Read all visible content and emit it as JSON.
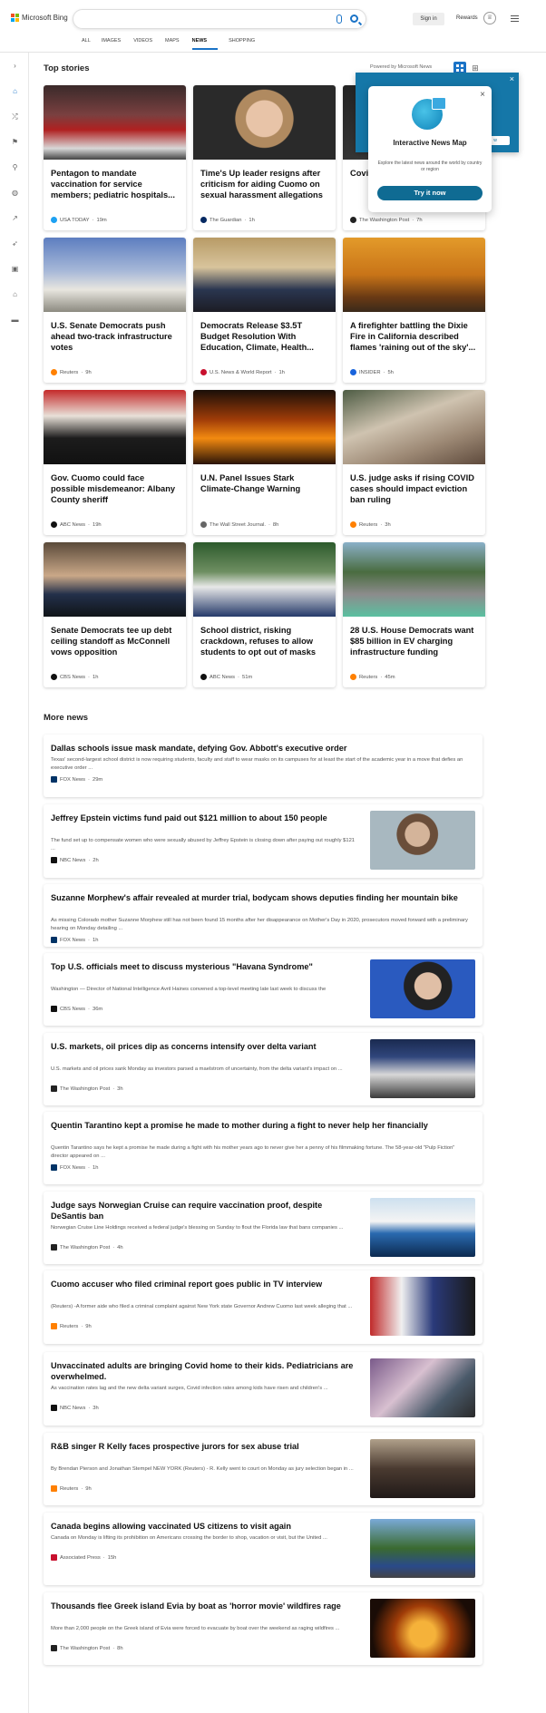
{
  "header": {
    "brand": "Microsoft Bing",
    "signin": "Sign in",
    "rewards": "Rewards",
    "scopes": [
      "ALL",
      "IMAGES",
      "VIDEOS",
      "MAPS",
      "NEWS",
      "SHOPPING"
    ],
    "active_scope": "NEWS"
  },
  "top_stories": {
    "title": "Top stories",
    "powered_by": "Powered by Microsoft News",
    "cards": [
      {
        "title": "Pentagon to mandate vaccination for service members; pediatric hospitals...",
        "source": "USA TODAY",
        "time": "19m",
        "color": "#1da1f2"
      },
      {
        "title": "Time's Up leader resigns after criticism for aiding Cuomo on sexual harassment allegations",
        "source": "The Guardian",
        "time": "1h",
        "color": "#052962"
      },
      {
        "title": "Covid... it's ta... kids",
        "source": "The Washington Post",
        "time": "7h",
        "color": "#222"
      },
      {
        "title": "U.S. Senate Democrats push ahead two-track infrastructure votes",
        "source": "Reuters",
        "time": "9h",
        "color": "#ff8000"
      },
      {
        "title": "Democrats Release $3.5T Budget Resolution With Education, Climate, Health...",
        "source": "U.S. News & World Report",
        "time": "1h",
        "color": "#c8102e"
      },
      {
        "title": "A firefighter battling the Dixie Fire in California described flames 'raining out of the sky'...",
        "source": "INSIDER",
        "time": "5h",
        "color": "#1863dc"
      },
      {
        "title": "Gov. Cuomo could face possible misdemeanor: Albany County sheriff",
        "source": "ABC News",
        "time": "19h",
        "color": "#111"
      },
      {
        "title": "U.N. Panel Issues Stark Climate-Change Warning",
        "source": "The Wall Street Journal.",
        "time": "8h",
        "color": "#666"
      },
      {
        "title": "U.S. judge asks if rising COVID cases should impact eviction ban ruling",
        "source": "Reuters",
        "time": "3h",
        "color": "#ff8000"
      },
      {
        "title": "Senate Democrats tee up debt ceiling standoff as McConnell vows opposition",
        "source": "CBS News",
        "time": "1h",
        "color": "#111"
      },
      {
        "title": "School district, risking crackdown, refuses to allow students to opt out of masks",
        "source": "ABC News",
        "time": "51m",
        "color": "#111"
      },
      {
        "title": "28 U.S. House Democrats want $85 billion in EV charging infrastructure funding",
        "source": "Reuters",
        "time": "45m",
        "color": "#ff8000"
      }
    ]
  },
  "popup": {
    "banner_text": "es",
    "banner_pill": "w",
    "heading": "Interactive News Map",
    "desc": "Explore the latest news around the world by country or region",
    "button": "Try it now"
  },
  "more_news": {
    "title": "More news",
    "items": [
      {
        "title": "Dallas schools issue mask mandate, defying Gov. Abbott's executive order",
        "desc": "Texas' second-largest school district is now requiring students, faculty and staff to wear masks on its campuses for at least the start of the academic year in a move that defies an executive order ...",
        "source": "FOX News",
        "time": "29m",
        "color": "#003366"
      },
      {
        "title": "Jeffrey Epstein victims fund paid out $121 million to about 150 people",
        "desc": "The fund set up to compensate women who were sexually abused by Jeffrey Epstein is closing down after paying out roughly $121 ...",
        "source": "NBC News",
        "time": "2h",
        "color": "#111"
      },
      {
        "title": "Suzanne Morphew's affair revealed at murder trial, bodycam shows deputies finding her mountain bike",
        "desc": "As missing Colorado mother Suzanne Morphew still has not been found 15 months after her disappearance on Mother's Day in 2020, prosecutors moved forward with a preliminary hearing on Monday detailing ...",
        "source": "FOX News",
        "time": "1h",
        "color": "#003366"
      },
      {
        "title": "Top U.S. officials meet to discuss mysterious \"Havana Syndrome\"",
        "desc": "Washington — Director of National Intelligence Avril Haines convened a top-level meeting late last week to discuss the",
        "source": "CBS News",
        "time": "36m",
        "color": "#111"
      },
      {
        "title": "U.S. markets, oil prices dip as concerns intensify over delta variant",
        "desc": "U.S. markets and oil prices sank Monday as investors parsed a maelstrom of uncertainty, from the delta variant's impact on ...",
        "source": "The Washington Post",
        "time": "3h",
        "color": "#222"
      },
      {
        "title": "Quentin Tarantino kept a promise he made to mother during a fight to never help her financially",
        "desc": "Quentin Tarantino says he kept a promise he made during a fight with his mother years ago to never give her a penny of his filmmaking fortune.  The 58-year-old \"Pulp Fiction\" director appeared on ...",
        "source": "FOX News",
        "time": "1h",
        "color": "#003366"
      },
      {
        "title": "Judge says Norwegian Cruise can require vaccination proof, despite DeSantis ban",
        "desc": "Norwegian Cruise Line Holdings received a federal judge's blessing on Sunday to flout the Florida law that bans companies ...",
        "source": "The Washington Post",
        "time": "4h",
        "color": "#222"
      },
      {
        "title": "Cuomo accuser who filed criminal report goes public in TV interview",
        "desc": "(Reuters) -A former aide who filed a criminal complaint against New York state Governor Andrew Cuomo last week alleging that ...",
        "source": "Reuters",
        "time": "9h",
        "color": "#ff8000"
      },
      {
        "title": "Unvaccinated adults are bringing Covid home to their kids. Pediatricians are overwhelmed.",
        "desc": "As vaccination rates lag and the new delta variant surges, Covid infection rates among kids have risen and children's ...",
        "source": "NBC News",
        "time": "3h",
        "color": "#111"
      },
      {
        "title": "R&B singer R Kelly faces prospective jurors for sex abuse trial",
        "desc": "By Brendan Pierson and Jonathan Stempel NEW YORK (Reuters) - R. Kelly went to court on Monday as jury selection began in ...",
        "source": "Reuters",
        "time": "9h",
        "color": "#ff8000"
      },
      {
        "title": "Canada begins allowing vaccinated US citizens to visit again",
        "desc": "Canada on Monday is lifting its prohibition on Americans crossing the border to shop, vacation or visit, but the United ...",
        "source": "Associated Press",
        "time": "15h",
        "color": "#c8102e"
      },
      {
        "title": "Thousands flee Greek island Evia by boat as 'horror movie' wildfires rage",
        "desc": "More than 2,000 people on the Greek island of Evia were forced to evacuate by boat over the weekend as raging wildfires ...",
        "source": "The Washington Post",
        "time": "8h",
        "color": "#222"
      }
    ]
  },
  "rail_icons": [
    "expand-icon",
    "home-icon",
    "shuffle-icon",
    "flag-icon",
    "pin-icon",
    "globe-icon",
    "chart-icon",
    "rocket-icon",
    "film-icon",
    "bank-icon",
    "car-icon"
  ]
}
